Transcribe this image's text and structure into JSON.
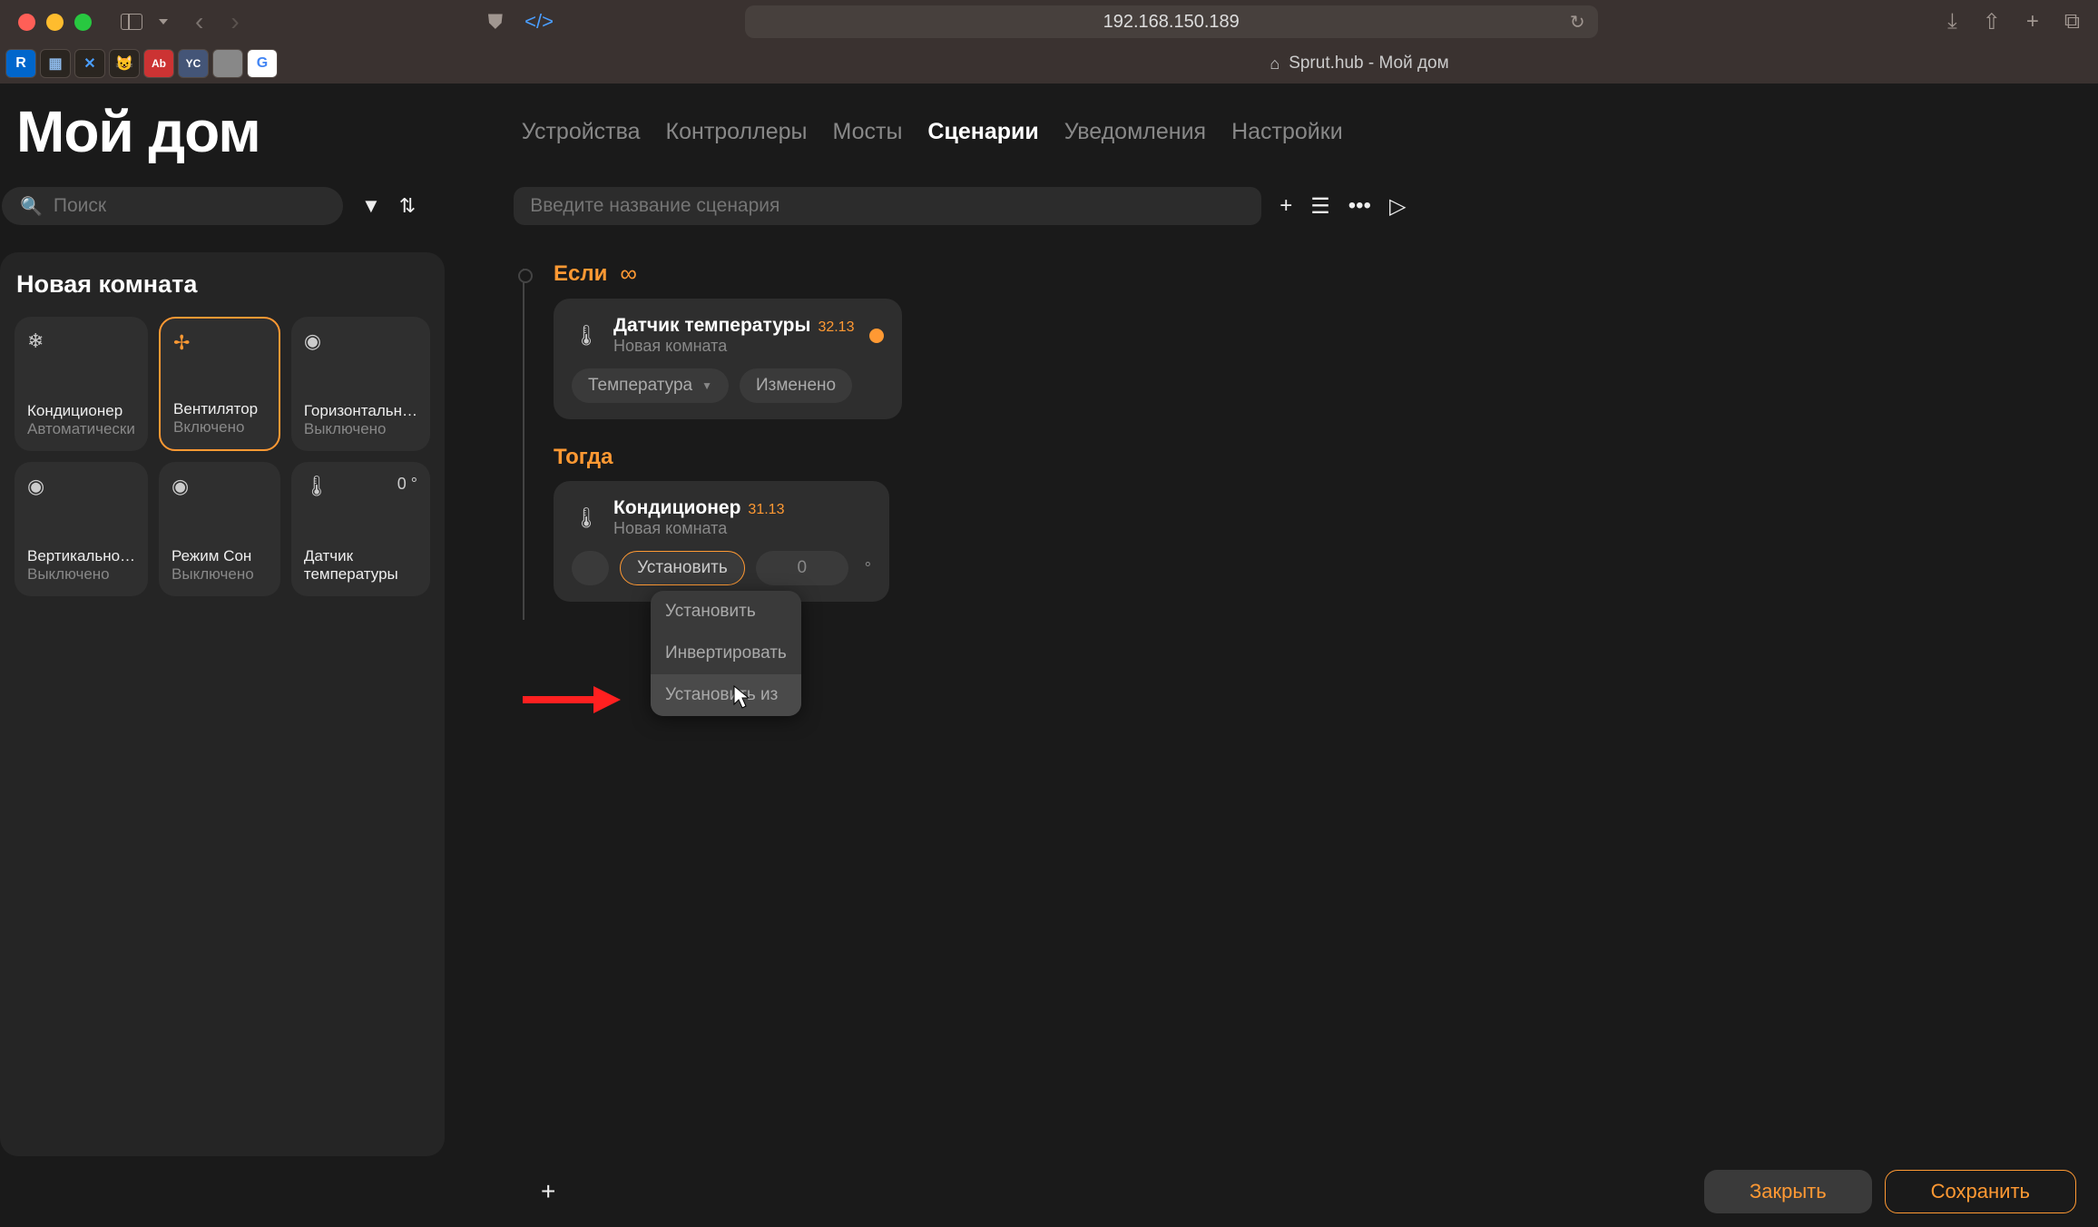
{
  "browser": {
    "url": "192.168.150.189",
    "tab_title": "Sprut.hub - Мой дом"
  },
  "app": {
    "title": "Мой дом",
    "nav": [
      {
        "label": "Устройства",
        "active": false
      },
      {
        "label": "Контроллеры",
        "active": false
      },
      {
        "label": "Мосты",
        "active": false
      },
      {
        "label": "Сценарии",
        "active": true
      },
      {
        "label": "Уведомления",
        "active": false
      },
      {
        "label": "Настройки",
        "active": false
      }
    ],
    "search_placeholder": "Поиск",
    "scenario_name_placeholder": "Введите название сценария"
  },
  "room": {
    "name": "Новая комната",
    "devices": [
      {
        "name": "Кондиционер",
        "status": "Автоматически",
        "icon": "snowflake",
        "active": false,
        "temp": null
      },
      {
        "name": "Вентилятор",
        "status": "Включено",
        "icon": "fan",
        "active": true,
        "temp": null
      },
      {
        "name": "Горизонтальн…",
        "status": "Выключено",
        "icon": "toggle",
        "active": false,
        "temp": null
      },
      {
        "name": "Вертикально…",
        "status": "Выключено",
        "icon": "toggle",
        "active": false,
        "temp": null
      },
      {
        "name": "Режим Сон",
        "status": "Выключено",
        "icon": "toggle",
        "active": false,
        "temp": null
      },
      {
        "name": "Датчик температуры",
        "status": "",
        "icon": "thermometer",
        "active": false,
        "temp": "0 °"
      }
    ]
  },
  "scenario": {
    "if_label": "Если",
    "then_label": "Тогда",
    "if_block": {
      "title": "Датчик температуры",
      "value": "32.13",
      "room": "Новая комната",
      "parameter": "Температура",
      "condition": "Изменено"
    },
    "then_block": {
      "title": "Кондиционер",
      "value": "31.13",
      "room": "Новая комната",
      "action": "Установить",
      "target_value": "0",
      "unit": "°"
    },
    "dropdown": {
      "options": [
        "Установить",
        "Инвертировать",
        "Установить из"
      ],
      "hovered_index": 2
    }
  },
  "footer": {
    "close": "Закрыть",
    "save": "Сохранить"
  }
}
